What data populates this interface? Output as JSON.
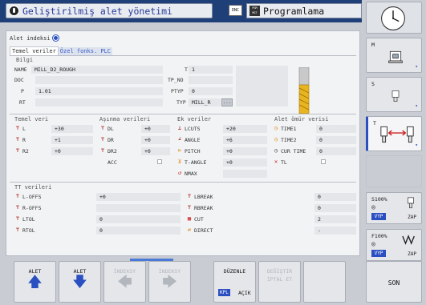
{
  "header": {
    "title": "Geliştirilmiş alet yönetimi",
    "dnc": "DNC",
    "mode_badge": "PGM MGT",
    "mode_title": "Programlama"
  },
  "index": {
    "label": "Alet indeksi"
  },
  "tabs": [
    {
      "label": "Temel veriler",
      "active": true
    },
    {
      "label": "Özel fonks. PLC",
      "active": false
    }
  ],
  "bilgi": {
    "title": "Bilgi",
    "name_label": "NAME",
    "name_value": "MILL_D2_ROUGH",
    "doc_label": "DOC",
    "doc_value": "",
    "p_label": "P",
    "p_value": "1.01",
    "rt_label": "RT",
    "rt_value": "",
    "t_label": "T",
    "t_value": "1",
    "tpno_label": "TP_NO",
    "tpno_value": "",
    "ptyp_label": "PTYP",
    "ptyp_value": "0",
    "typ_label": "TYP",
    "typ_value": "MILL_R",
    "typ_btn": "..."
  },
  "temel": {
    "title": "Temel veri",
    "rows": [
      {
        "label": "L",
        "value": "+30"
      },
      {
        "label": "R",
        "value": "+1"
      },
      {
        "label": "R2",
        "value": "+0"
      }
    ]
  },
  "asinma": {
    "title": "Aşınma verileri",
    "rows": [
      {
        "label": "DL",
        "value": "+0"
      },
      {
        "label": "DR",
        "value": "+0"
      },
      {
        "label": "DR2",
        "value": "+0"
      }
    ],
    "acc_label": "ACC"
  },
  "ek": {
    "title": "Ek veriler",
    "rows": [
      {
        "label": "LCUTS",
        "value": "+20"
      },
      {
        "label": "ANGLE",
        "value": "+6"
      },
      {
        "label": "PITCH",
        "value": "+0"
      },
      {
        "label": "T-ANGLE",
        "value": "+0"
      },
      {
        "label": "NMAX",
        "value": ""
      }
    ]
  },
  "omur": {
    "title": "Alet ömür verisi",
    "rows": [
      {
        "label": "TIME1",
        "value": "0"
      },
      {
        "label": "TIME2",
        "value": "0"
      },
      {
        "label": "CUR TIME",
        "value": "0"
      },
      {
        "label": "TL",
        "value": ""
      }
    ]
  },
  "tt": {
    "title": "TT verileri",
    "left": [
      {
        "label": "L-OFFS",
        "value": "+0"
      },
      {
        "label": "R-OFFS",
        "value": ""
      },
      {
        "label": "LTOL",
        "value": "0"
      },
      {
        "label": "RTOL",
        "value": "0"
      }
    ],
    "right": [
      {
        "label": "LBREAK",
        "value": "0"
      },
      {
        "label": "RBREAK",
        "value": "0"
      },
      {
        "label": "CUT",
        "value": "2"
      },
      {
        "label": "DIRECT",
        "value": "-"
      }
    ]
  },
  "right_keys": {
    "m": "M",
    "s": "S",
    "t": "T",
    "s_override": "S100%",
    "f_override": "F100%",
    "vyp": "VYP",
    "zap": "ZAP"
  },
  "bottom_keys": {
    "alet_up": "ALET",
    "alet_down": "ALET",
    "index_left": "İNDEKSY",
    "index_right": "İNDEKSY",
    "duzenle": "DÜZENLE",
    "kpl": "KPL",
    "acik": "AÇIK",
    "degistir_1": "DEĞİŞTİR",
    "degistir_2": "İPTAL ET",
    "son": "SON"
  },
  "colors": {
    "header_bg": "#1f3f78",
    "accent": "#2a4fc0",
    "panel": "#f2f3f5"
  }
}
